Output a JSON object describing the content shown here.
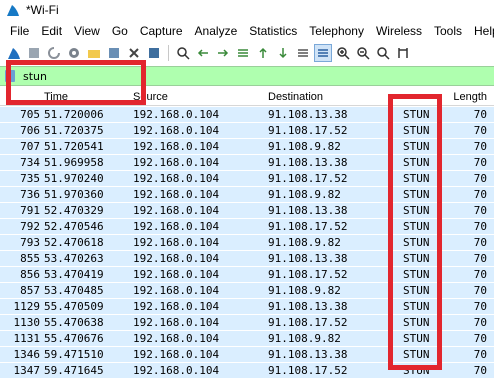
{
  "window": {
    "title": "*Wi-Fi"
  },
  "menubar": [
    "File",
    "Edit",
    "View",
    "Go",
    "Capture",
    "Analyze",
    "Statistics",
    "Telephony",
    "Wireless",
    "Tools",
    "Help"
  ],
  "toolbar": [
    {
      "icon": "shark-fin-start-icon"
    },
    {
      "icon": "stop-square-icon"
    },
    {
      "icon": "restart-capture-icon"
    },
    {
      "icon": "capture-options-gear-icon"
    },
    {
      "icon": "open-folder-icon"
    },
    {
      "icon": "save-file-icon"
    },
    {
      "icon": "close-file-icon"
    },
    {
      "icon": "reload-icon"
    },
    {
      "icon": "find-magnifier-icon"
    },
    {
      "icon": "go-back-arrow-icon"
    },
    {
      "icon": "go-forward-arrow-icon"
    },
    {
      "icon": "go-to-packet-icon"
    },
    {
      "icon": "go-first-icon"
    },
    {
      "icon": "go-last-icon"
    },
    {
      "icon": "auto-scroll-icon"
    },
    {
      "icon": "colorize-icon"
    },
    {
      "icon": "zoom-in-icon"
    },
    {
      "icon": "zoom-out-icon"
    },
    {
      "icon": "zoom-normal-icon"
    },
    {
      "icon": "resize-columns-icon"
    }
  ],
  "filter": {
    "value": "stun"
  },
  "columns": {
    "no": "",
    "time": "Time",
    "source": "Source",
    "destination": "Destination",
    "protocol": "",
    "length": "Length"
  },
  "packets": [
    {
      "no": "705",
      "time": "51.720006",
      "source": "192.168.0.104",
      "destination": "91.108.13.38",
      "protocol": "STUN",
      "length": "70"
    },
    {
      "no": "706",
      "time": "51.720375",
      "source": "192.168.0.104",
      "destination": "91.108.17.52",
      "protocol": "STUN",
      "length": "70"
    },
    {
      "no": "707",
      "time": "51.720541",
      "source": "192.168.0.104",
      "destination": "91.108.9.82",
      "protocol": "STUN",
      "length": "70"
    },
    {
      "no": "734",
      "time": "51.969958",
      "source": "192.168.0.104",
      "destination": "91.108.13.38",
      "protocol": "STUN",
      "length": "70"
    },
    {
      "no": "735",
      "time": "51.970240",
      "source": "192.168.0.104",
      "destination": "91.108.17.52",
      "protocol": "STUN",
      "length": "70"
    },
    {
      "no": "736",
      "time": "51.970360",
      "source": "192.168.0.104",
      "destination": "91.108.9.82",
      "protocol": "STUN",
      "length": "70"
    },
    {
      "no": "791",
      "time": "52.470329",
      "source": "192.168.0.104",
      "destination": "91.108.13.38",
      "protocol": "STUN",
      "length": "70"
    },
    {
      "no": "792",
      "time": "52.470546",
      "source": "192.168.0.104",
      "destination": "91.108.17.52",
      "protocol": "STUN",
      "length": "70"
    },
    {
      "no": "793",
      "time": "52.470618",
      "source": "192.168.0.104",
      "destination": "91.108.9.82",
      "protocol": "STUN",
      "length": "70"
    },
    {
      "no": "855",
      "time": "53.470263",
      "source": "192.168.0.104",
      "destination": "91.108.13.38",
      "protocol": "STUN",
      "length": "70"
    },
    {
      "no": "856",
      "time": "53.470419",
      "source": "192.168.0.104",
      "destination": "91.108.17.52",
      "protocol": "STUN",
      "length": "70"
    },
    {
      "no": "857",
      "time": "53.470485",
      "source": "192.168.0.104",
      "destination": "91.108.9.82",
      "protocol": "STUN",
      "length": "70"
    },
    {
      "no": "1129",
      "time": "55.470509",
      "source": "192.168.0.104",
      "destination": "91.108.13.38",
      "protocol": "STUN",
      "length": "70"
    },
    {
      "no": "1130",
      "time": "55.470638",
      "source": "192.168.0.104",
      "destination": "91.108.17.52",
      "protocol": "STUN",
      "length": "70"
    },
    {
      "no": "1131",
      "time": "55.470676",
      "source": "192.168.0.104",
      "destination": "91.108.9.82",
      "protocol": "STUN",
      "length": "70"
    },
    {
      "no": "1346",
      "time": "59.471510",
      "source": "192.168.0.104",
      "destination": "91.108.13.38",
      "protocol": "STUN",
      "length": "70"
    },
    {
      "no": "1347",
      "time": "59.471645",
      "source": "192.168.0.104",
      "destination": "91.108.17.52",
      "protocol": "STUN",
      "length": "70"
    }
  ],
  "colors": {
    "row_bg": "#daeeff",
    "filter_bg": "#afffaf",
    "highlight": "#e2262e"
  }
}
